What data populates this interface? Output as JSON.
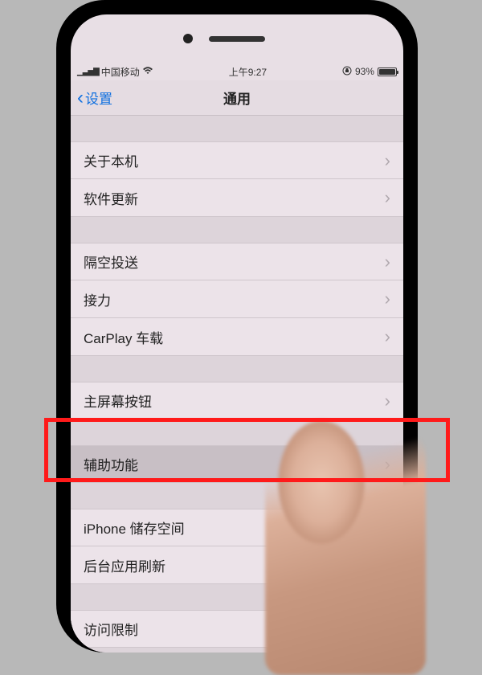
{
  "status": {
    "carrier": "中国移动",
    "time": "上午9:27",
    "battery_pct": "93%"
  },
  "nav": {
    "back_label": "设置",
    "title": "通用"
  },
  "groups": [
    {
      "items": [
        {
          "label": "关于本机",
          "key": "about"
        },
        {
          "label": "软件更新",
          "key": "software-update"
        }
      ]
    },
    {
      "items": [
        {
          "label": "隔空投送",
          "key": "airdrop"
        },
        {
          "label": "接力",
          "key": "handoff"
        },
        {
          "label": "CarPlay 车载",
          "key": "carplay"
        }
      ]
    },
    {
      "items": [
        {
          "label": "主屏幕按钮",
          "key": "home-button"
        }
      ]
    },
    {
      "items": [
        {
          "label": "辅助功能",
          "key": "accessibility"
        }
      ]
    },
    {
      "items": [
        {
          "label": "iPhone 储存空间",
          "key": "iphone-storage"
        },
        {
          "label": "后台应用刷新",
          "key": "background-refresh"
        }
      ]
    },
    {
      "items": [
        {
          "label": "访问限制",
          "key": "restrictions"
        }
      ]
    }
  ]
}
